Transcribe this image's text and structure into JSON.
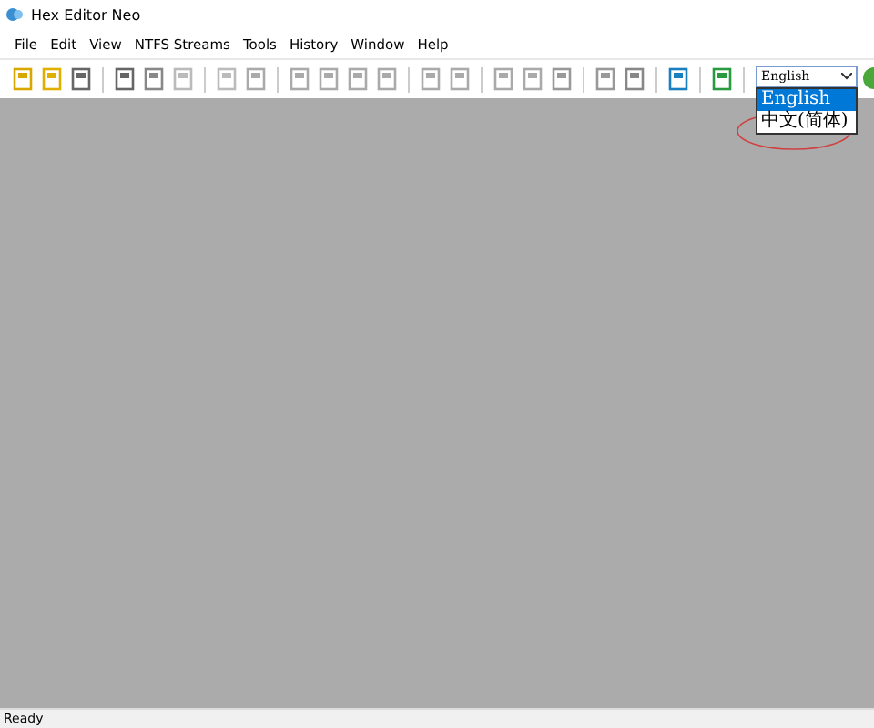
{
  "window": {
    "title": "Hex Editor Neo"
  },
  "menu": [
    "File",
    "Edit",
    "View",
    "NTFS Streams",
    "Tools",
    "History",
    "Window",
    "Help"
  ],
  "language_select": {
    "value": "English",
    "expanded": true,
    "options": [
      {
        "label": "English",
        "selected": true
      },
      {
        "label": "中文(简体)",
        "selected": false
      }
    ]
  },
  "status_bar": "Ready"
}
